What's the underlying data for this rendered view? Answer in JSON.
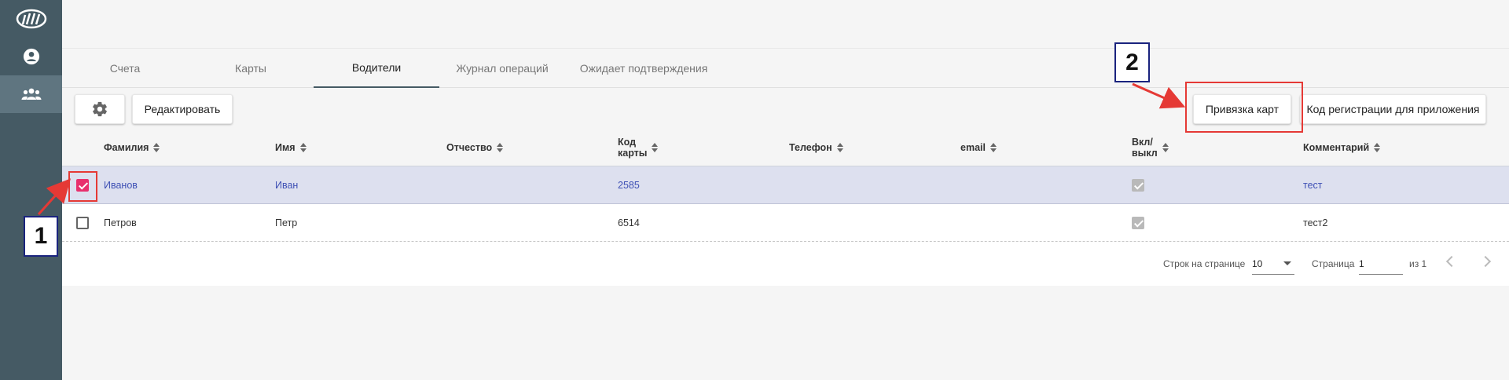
{
  "sidebar": {
    "items": [
      {
        "icon": "logo-icon"
      },
      {
        "icon": "account-circle-icon"
      },
      {
        "icon": "group-icon"
      }
    ]
  },
  "tabs": [
    {
      "label": "Счета",
      "active": false
    },
    {
      "label": "Карты",
      "active": false
    },
    {
      "label": "Водители",
      "active": true
    },
    {
      "label": "Журнал операций",
      "active": false
    },
    {
      "label": "Ожидает подтверждения",
      "active": false
    }
  ],
  "toolbar": {
    "settings_icon": "gear-icon",
    "edit_label": "Редактировать",
    "bind_cards_label": "Привязка карт",
    "reg_code_label": "Код регистрации для приложения"
  },
  "table": {
    "columns": [
      "Фамилия",
      "Имя",
      "Отчество",
      "Код\nкарты",
      "Телефон",
      "email",
      "Вкл/\nвыкл",
      "Комментарий"
    ],
    "rows": [
      {
        "selected": true,
        "last_name": "Иванов",
        "first_name": "Иван",
        "middle_name": "",
        "card_code": "2585",
        "phone": "",
        "email": "",
        "enabled": true,
        "comment": "тест"
      },
      {
        "selected": false,
        "last_name": "Петров",
        "first_name": "Петр",
        "middle_name": "",
        "card_code": "6514",
        "phone": "",
        "email": "",
        "enabled": true,
        "comment": "тест2"
      }
    ]
  },
  "pagination": {
    "rows_per_page_label": "Строк на странице",
    "rows_per_page_value": "10",
    "page_label": "Страница",
    "page_value": "1",
    "of_label": "из 1"
  },
  "annotations": {
    "step1": "1",
    "step2": "2",
    "color": "#e53935"
  }
}
